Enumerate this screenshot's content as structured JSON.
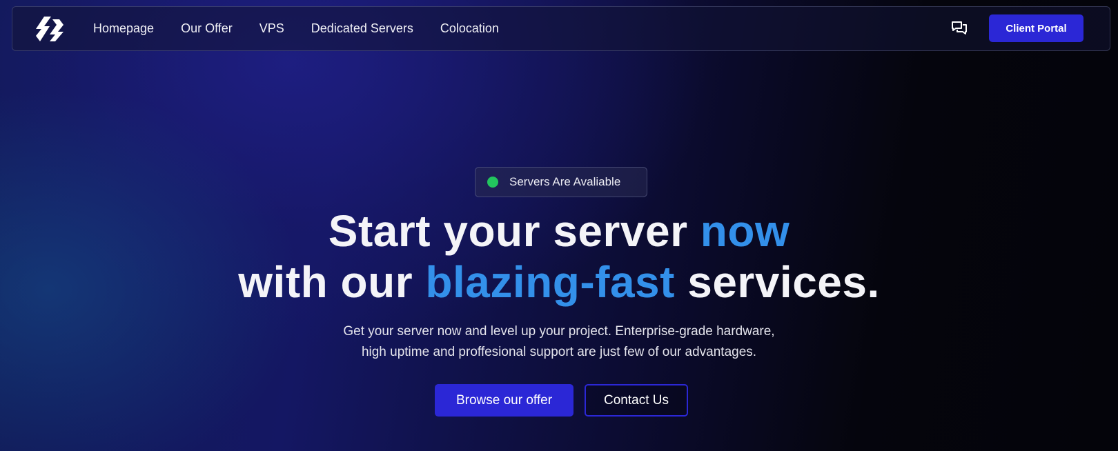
{
  "nav": {
    "logo_icon": "brand-logo-icon",
    "links": [
      {
        "label": "Homepage"
      },
      {
        "label": "Our Offer"
      },
      {
        "label": "VPS"
      },
      {
        "label": "Dedicated Servers"
      },
      {
        "label": "Colocation"
      }
    ],
    "chat_icon": "chat-bubbles-icon",
    "portal_label": "Client Portal"
  },
  "hero": {
    "status": {
      "label": "Servers Are Avaliable",
      "dot_color": "#22c55e"
    },
    "headline": {
      "line1_part1": "Start your server ",
      "line1_highlight": "now",
      "line2_part1": "with our ",
      "line2_highlight": "blazing-fast",
      "line2_part2": " services."
    },
    "subtext": {
      "line1": "Get your server now and level up your project. Enterprise-grade hardware,",
      "line2": "high uptime and proffesional support are just few of our advantages."
    },
    "cta_primary": "Browse our offer",
    "cta_secondary": "Contact Us"
  },
  "colors": {
    "accent": "#2b27d6",
    "highlight": "#3390ea",
    "background": "#05050d"
  }
}
